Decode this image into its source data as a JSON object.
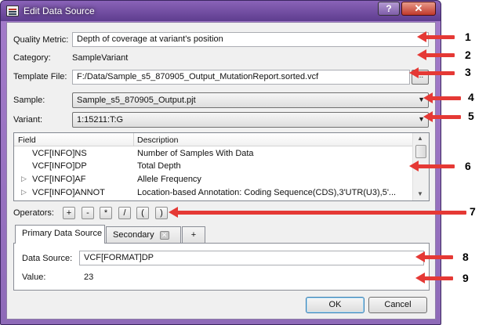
{
  "window": {
    "title": "Edit Data Source",
    "help_label": "?",
    "close_label": "✕"
  },
  "form": {
    "quality_metric_label": "Quality Metric:",
    "quality_metric_value": "Depth of coverage at variant's position",
    "category_label": "Category:",
    "category_value": "SampleVariant",
    "template_file_label": "Template File:",
    "template_file_value": "F:/Data/Sample_s5_870905_Output_MutationReport.sorted.vcf",
    "browse_label": "...",
    "sample_label": "Sample:",
    "sample_value": "Sample_s5_870905_Output.pjt",
    "variant_label": "Variant:",
    "variant_value": "1:15211:T:G"
  },
  "table": {
    "headers": {
      "field": "Field",
      "description": "Description"
    },
    "rows": [
      {
        "field": "VCF[INFO]NS",
        "description": "Number of Samples With Data",
        "expandable": false
      },
      {
        "field": "VCF[INFO]DP",
        "description": "Total Depth",
        "expandable": false
      },
      {
        "field": "VCF[INFO]AF",
        "description": "Allele Frequency",
        "expandable": true
      },
      {
        "field": "VCF[INFO]ANNOT",
        "description": "Location-based Annotation: Coding Sequence(CDS),3'UTR(U3),5'...",
        "expandable": true
      }
    ]
  },
  "operators": {
    "label": "Operators:",
    "buttons": [
      "+",
      "-",
      "*",
      "/",
      "(",
      ")"
    ]
  },
  "tabs": [
    {
      "label": "Primary Data Source",
      "active": true
    },
    {
      "label": "Secondary",
      "active": false
    },
    {
      "label": "+",
      "active": false
    }
  ],
  "tab_content": {
    "data_source_label": "Data Source:",
    "data_source_value": "VCF[FORMAT]DP",
    "value_label": "Value:",
    "value_value": "23"
  },
  "buttons": {
    "ok": "OK",
    "cancel": "Cancel"
  },
  "annotations": [
    "1",
    "2",
    "3",
    "4",
    "5",
    "6",
    "7",
    "8",
    "9"
  ],
  "colors": {
    "annotation_arrow": "#e53935",
    "title_bar": "#5e3d8f",
    "close_button": "#c0392b"
  }
}
